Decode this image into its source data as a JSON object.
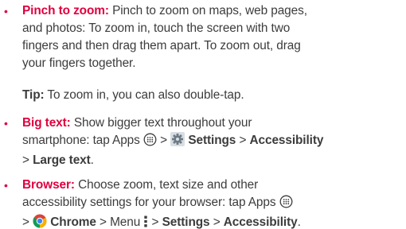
{
  "pinch": {
    "term": "Pinch to zoom:",
    "l1": " Pinch to zoom on maps, web pages,",
    "l2": "and photos: To zoom in, touch the screen with two",
    "l3": "fingers and then drag them apart. To zoom out, drag",
    "l4": "your fingers together."
  },
  "tip": {
    "label": "Tip:",
    "text": " To zoom in, you can also double-tap."
  },
  "big_text": {
    "term": "Big text:",
    "l1": " Show bigger text throughout your",
    "l2a": "smartphone: tap Apps ",
    "sep1": " > ",
    "settings": "Settings",
    "sep2": " > ",
    "accessibility": "Accessibility",
    "l3a": "> ",
    "large_text": "Large text",
    "l3b": "."
  },
  "browser": {
    "term": "Browser:",
    "l1": " Choose zoom, text size and other",
    "l2": "accessibility settings for your browser: tap Apps ",
    "l3a": "> ",
    "chrome": "Chrome",
    "sep1": " > Menu ",
    "sep2": " > ",
    "settings": "Settings",
    "sep3": " > ",
    "accessibility": "Accessibility",
    "end": "."
  },
  "bullet_char": "•",
  "colors": {
    "accent": "#e0003c",
    "text": "#3c3c3c"
  },
  "icons": [
    "apps-icon",
    "settings-gear-icon",
    "chrome-icon",
    "menu-icon"
  ]
}
